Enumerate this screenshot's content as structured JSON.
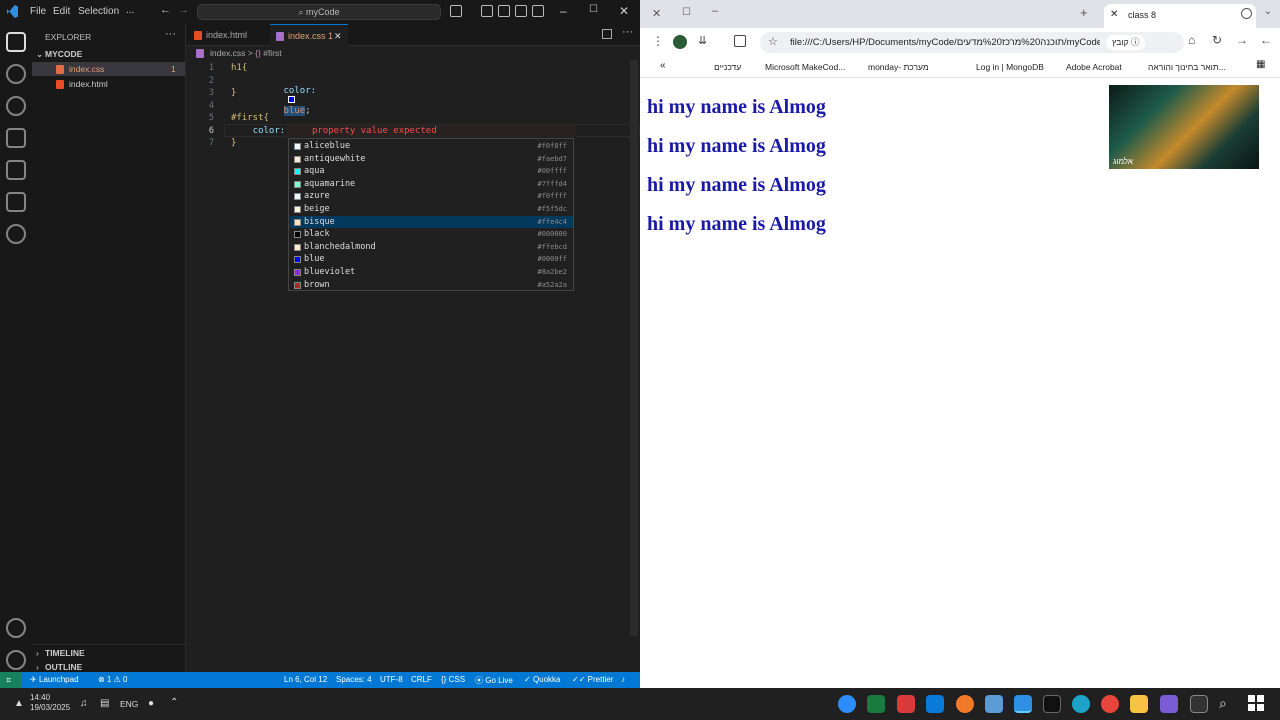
{
  "vscode": {
    "menu": [
      "File",
      "Edit",
      "Selection",
      "..."
    ],
    "command_center": "myCode",
    "explorer": {
      "header": "EXPLORER",
      "folder": "MYCODE",
      "files": [
        {
          "name": "index.css",
          "badge": "1"
        },
        {
          "name": "index.html",
          "badge": ""
        }
      ],
      "timeline": "TIMELINE",
      "outline": "OUTLINE"
    },
    "tabs": [
      {
        "label": "index.html"
      },
      {
        "label": "index.css 1"
      }
    ],
    "breadcrumb": {
      "file": "index.css",
      "sep": ">",
      "symbol": "#first"
    },
    "code_lines": [
      {
        "num": "1",
        "text": "h1{"
      },
      {
        "num": "2",
        "text": "    color: ",
        "value": "blue",
        ";": ";"
      },
      {
        "num": "3",
        "text": "}"
      },
      {
        "num": "4",
        "text": ""
      },
      {
        "num": "5",
        "text": "#first{"
      },
      {
        "num": "6",
        "text": "    color: ;"
      },
      {
        "num": "7",
        "text": "}"
      }
    ],
    "line2_prefix": "color:",
    "line2_value": "blue",
    "line2_suffix": ";",
    "error_hint": "property value expected",
    "suggestions": [
      {
        "name": "aliceblue",
        "hex": "#f0f8ff",
        "color": "#f0f8ff"
      },
      {
        "name": "antiquewhite",
        "hex": "#faebd7",
        "color": "#faebd7"
      },
      {
        "name": "aqua",
        "hex": "#00ffff",
        "color": "#00ffff"
      },
      {
        "name": "aquamarine",
        "hex": "#7fffd4",
        "color": "#7fffd4"
      },
      {
        "name": "azure",
        "hex": "#f0ffff",
        "color": "#f0ffff"
      },
      {
        "name": "beige",
        "hex": "#f5f5dc",
        "color": "#f5f5dc"
      },
      {
        "name": "bisque",
        "hex": "#ffe4c4",
        "color": "#ffe4c4",
        "selected": true
      },
      {
        "name": "black",
        "hex": "#000000",
        "color": "#000000"
      },
      {
        "name": "blanchedalmond",
        "hex": "#ffebcd",
        "color": "#ffebcd"
      },
      {
        "name": "blue",
        "hex": "#0000ff",
        "color": "#0000ff"
      },
      {
        "name": "blueviolet",
        "hex": "#8a2be2",
        "color": "#8a2be2"
      },
      {
        "name": "brown",
        "hex": "#a52a2a",
        "color": "#a52a2a"
      }
    ],
    "status": {
      "launchpad": "Launchpad",
      "problems": "⊗ 1 ⚠ 0",
      "position": "Ln 6, Col 12",
      "spaces": "Spaces: 4",
      "encoding": "UTF-8",
      "eol": "CRLF",
      "language": "CSS",
      "golive": "Go Live",
      "quokka": "Quokka",
      "prettier": "Prettier"
    }
  },
  "browser": {
    "tab_title": "class 8",
    "url": "file:///C:/Users/HP/Documents/myCode/תוכנה%20מרכז%20מדעים/myCode/inde...",
    "url_chip": "קובץ",
    "bookmarks": [
      "עדכניים",
      "Microsoft MakeCod...",
      "monday- מערכת",
      "Log in | MongoDB",
      "Adobe Acrobat",
      "תואר בחינוך והוראה..."
    ],
    "headings": [
      "hi my name is Almog",
      "hi my name is Almog",
      "hi my name is Almog",
      "hi my name is Almog"
    ],
    "video_label": "אלמוג"
  },
  "taskbar": {
    "time": "14:40",
    "date": "19/03/2025",
    "lang": "ENG"
  }
}
